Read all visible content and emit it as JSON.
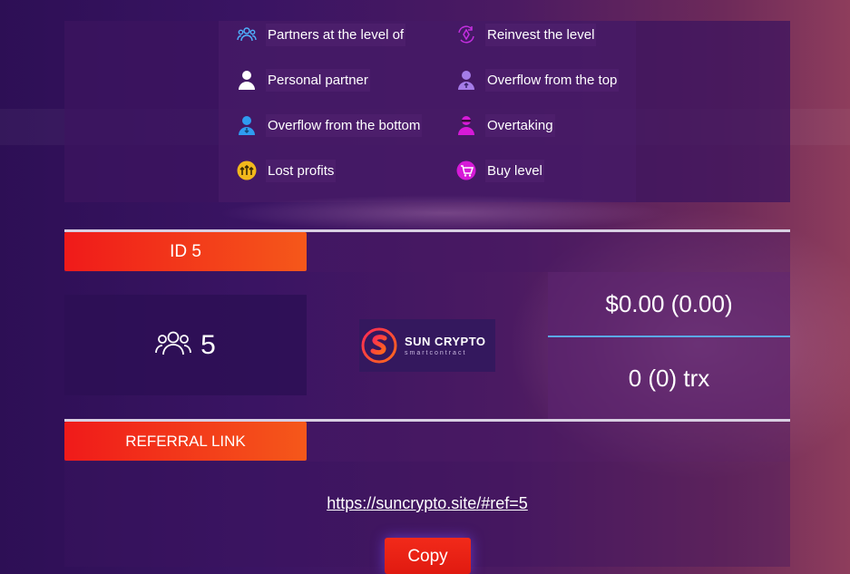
{
  "legend": {
    "left": [
      {
        "label": "Partners at the level of",
        "icon": "partners-outline-icon"
      },
      {
        "label": "Personal partner",
        "icon": "person-white-icon"
      },
      {
        "label": "Overflow from the bottom",
        "icon": "person-blue-icon"
      },
      {
        "label": "Lost profits",
        "icon": "arrows-up-yellow-icon"
      }
    ],
    "right": [
      {
        "label": "Reinvest the level",
        "icon": "reinvest-magenta-icon"
      },
      {
        "label": "Overflow from the top",
        "icon": "person-purple-icon"
      },
      {
        "label": "Overtaking",
        "icon": "ninja-magenta-icon"
      },
      {
        "label": "Buy level",
        "icon": "cart-magenta-icon"
      }
    ]
  },
  "id_tab": {
    "label": "ID 5"
  },
  "partners": {
    "count": "5",
    "icon": "partners-outline-icon"
  },
  "logo": {
    "name": "SUN CRYPTO",
    "sub": "smartcontract"
  },
  "balance": {
    "usd": "$0.00 (0.00)",
    "trx": "0 (0) trx"
  },
  "referral": {
    "tab_label": "REFERRAL LINK",
    "link": "https://suncrypto.site/#ref=5",
    "copy_label": "Copy"
  },
  "colors": {
    "accent_red": "#f01a1a",
    "accent_orange": "#f5581a",
    "separator_blue": "#5aa9e6"
  }
}
